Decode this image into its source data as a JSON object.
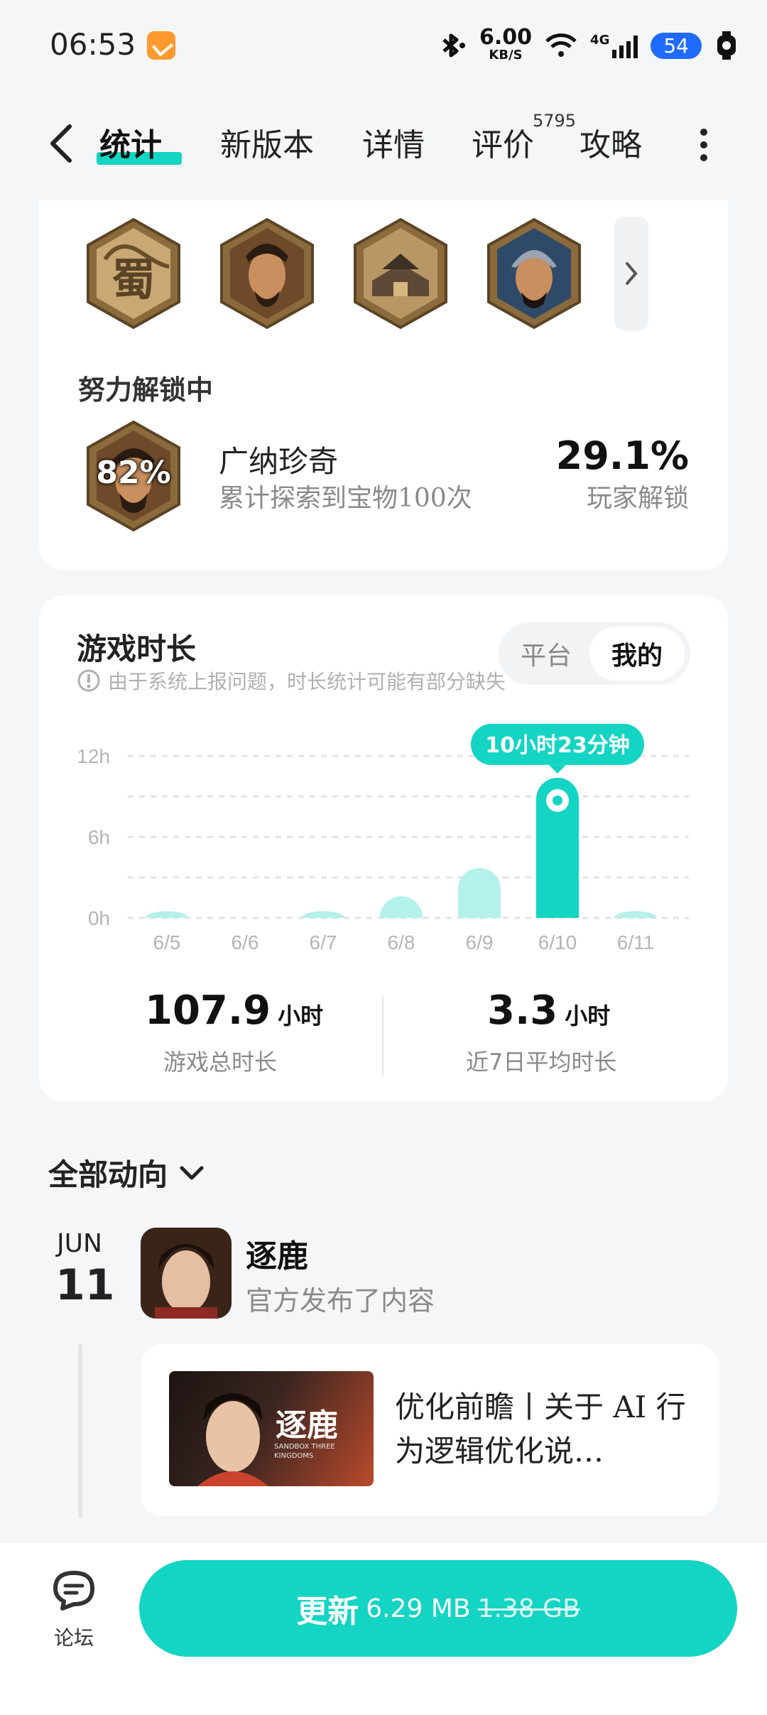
{
  "status": {
    "time": "06:53",
    "net_speed": "6.00",
    "net_unit": "KB/S",
    "signal": "4G",
    "battery": "54"
  },
  "tabs": [
    {
      "label": "统计"
    },
    {
      "label": "新版本"
    },
    {
      "label": "详情"
    },
    {
      "label": "评价"
    },
    {
      "label": "攻略"
    }
  ],
  "review_count": "5795",
  "achievements": {
    "badges": [
      {
        "icon": "shu-emblem-icon"
      },
      {
        "icon": "general-portrait-icon"
      },
      {
        "icon": "city-icon"
      },
      {
        "icon": "warrior-portrait-icon"
      }
    ],
    "in_progress_label": "努力解锁中",
    "item": {
      "progress": "82%",
      "title": "广纳珍奇",
      "desc": "累计探索到宝物100次",
      "unlock_pct": "29.1%",
      "unlock_label": "玩家解锁"
    }
  },
  "playtime": {
    "title": "游戏时长",
    "note": "由于系统上报问题，时长统计可能有部分缺失",
    "toggle": [
      "平台",
      "我的"
    ],
    "tooltip": "10小时23分钟",
    "total_value": "107.9",
    "total_unit": "小时",
    "total_label": "游戏总时长",
    "avg_value": "3.3",
    "avg_unit": "小时",
    "avg_label": "近7日平均时长"
  },
  "chart_data": {
    "type": "bar",
    "categories": [
      "6/5",
      "6/6",
      "6/7",
      "6/8",
      "6/9",
      "6/10",
      "6/11"
    ],
    "values": [
      0.5,
      0,
      0.5,
      1.6,
      3.7,
      10.38,
      0.5
    ],
    "ylim": [
      0,
      12
    ],
    "yticks": [
      "0h",
      "6h",
      "12h"
    ],
    "highlight_index": 5,
    "colors": {
      "bar": "#b3f1ea",
      "highlight": "#14d4c3"
    }
  },
  "feed": {
    "filter_label": "全部动向",
    "month": "JUN",
    "day": "11",
    "name": "逐鹿",
    "action": "官方发布了内容",
    "post_title": "优化前瞻丨关于 AI 行为逻辑优化说…",
    "thumb_title": "逐鹿",
    "thumb_sub": "SANDBOX THREE KINGDOMS"
  },
  "bottom": {
    "forum_label": "论坛",
    "update_label": "更新",
    "update_size": "6.29 MB",
    "old_size": "1.38 GB"
  },
  "colors": {
    "accent": "#14d4c3",
    "background": "#f5f6f8"
  }
}
